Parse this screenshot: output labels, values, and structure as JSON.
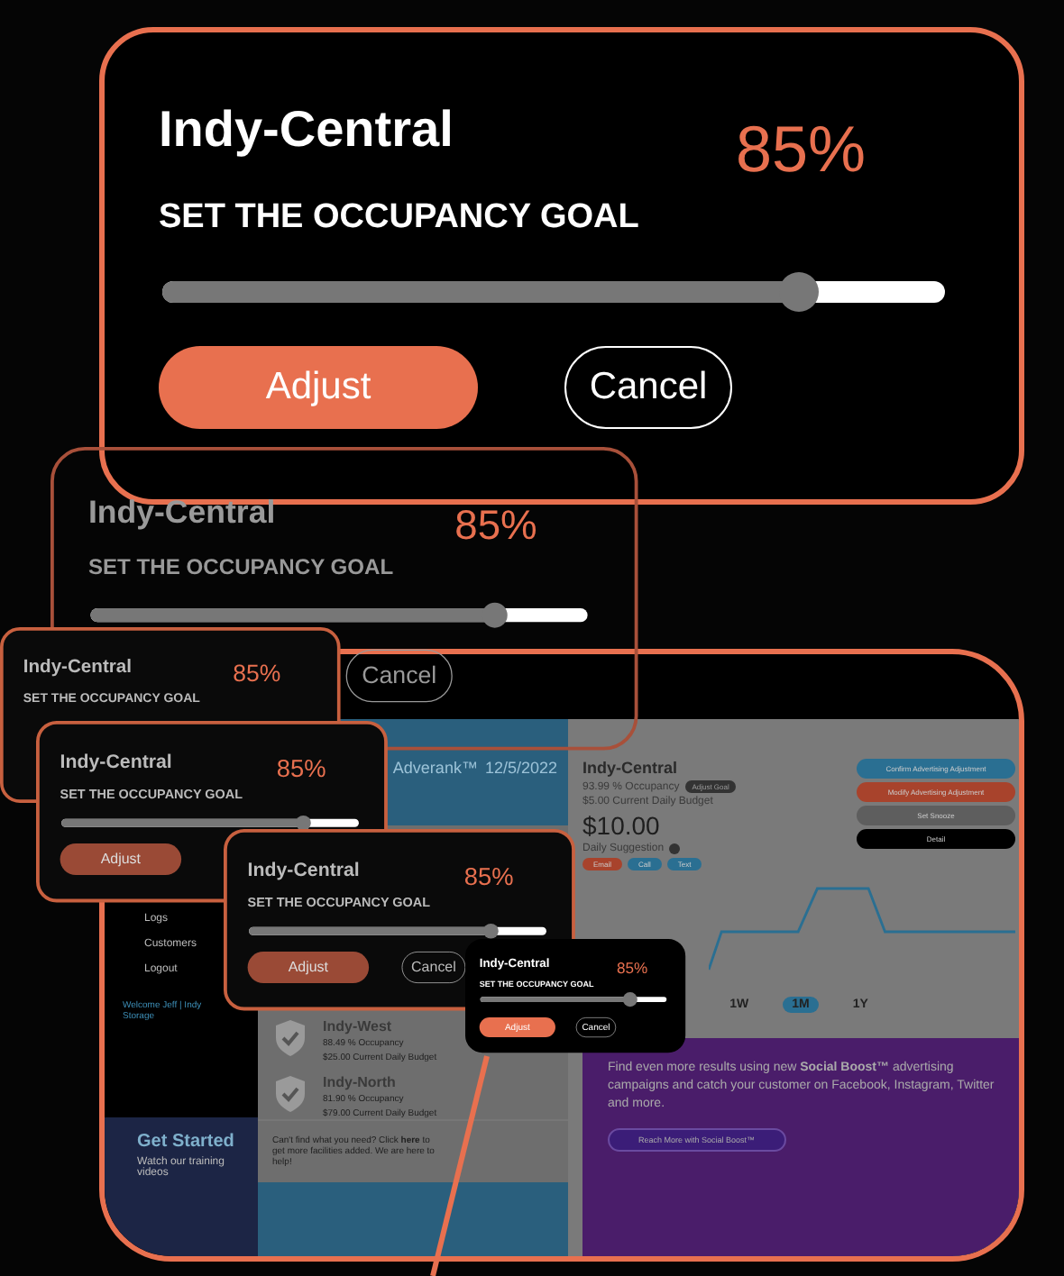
{
  "app": {
    "sidebar": {
      "items": [
        {
          "label": "Logs"
        },
        {
          "label": "Customers"
        },
        {
          "label": "Logout"
        }
      ],
      "welcome": "Welcome Jeff | Indy Storage",
      "get_started": {
        "title": "Get Started",
        "subtitle": "Watch our training videos"
      }
    },
    "header": {
      "brand": "Adverank™",
      "date": "12/5/2022"
    },
    "facilities": [
      {
        "name": "Indy-West",
        "occupancy": "88.49 % Occupancy",
        "budget": "$25.00 Current Daily Budget",
        "checked": true
      },
      {
        "name": "Indy-North",
        "occupancy": "81.90 % Occupancy",
        "budget": "$79.00 Current Daily Budget",
        "checked": true
      }
    ],
    "footer": "Can't find what you need? Click **here** to get more facilities added. We are here to help!",
    "detail": {
      "name": "Indy-Central",
      "occupancy": "93.99 % Occupancy",
      "adjust_goal": "Adjust Goal",
      "budget": "$5.00 Current Daily Budget",
      "amount": "$10.00",
      "suggestion": "Daily Suggestion",
      "contacts": [
        {
          "label": "Email",
          "color": "#a8432c"
        },
        {
          "label": "Call",
          "color": "#2a6f92"
        },
        {
          "label": "Text",
          "color": "#2a6f92"
        }
      ],
      "actions": [
        {
          "label": "Confirm Advertising Adjustment",
          "color": "#2a6f92"
        },
        {
          "label": "Modify Advertising Adjustment",
          "color": "#a8432c"
        },
        {
          "label": "Set Snooze",
          "color": "#5e5e5e"
        },
        {
          "label": "Detail",
          "color": "#000000"
        }
      ],
      "ranges": [
        {
          "label": "1W",
          "selected": false
        },
        {
          "label": "1M",
          "selected": true
        },
        {
          "label": "1Y",
          "selected": false
        }
      ],
      "promo": {
        "text": "Find even more results using new **Social Boost™** advertising campaigns and catch your customer on Facebook, Instagram, Twitter and more.",
        "button": "Reach More with Social Boost™"
      }
    }
  },
  "dialogs": [
    {
      "kind": "main",
      "title": "Indy-Central",
      "percent": "85%",
      "heading": "SET THE OCCUPANCY GOAL",
      "level": 0.83,
      "adjust": "Adjust",
      "cancel": "Cancel"
    },
    {
      "kind": "ghost",
      "title": "Indy-Central",
      "percent": "85%",
      "heading": "SET THE OCCUPANCY GOAL",
      "level": 0.83,
      "cancel": "Cancel"
    },
    {
      "kind": "echo",
      "title": "Indy-Central",
      "percent": "85%",
      "heading": "SET THE OCCUPANCY GOAL"
    },
    {
      "kind": "echo",
      "title": "Indy-Central",
      "percent": "85%",
      "heading": "SET THE OCCUPANCY GOAL",
      "level": 0.83,
      "adjust": "Adjust"
    },
    {
      "kind": "echo",
      "title": "Indy-Central",
      "percent": "85%",
      "heading": "SET THE OCCUPANCY GOAL",
      "level": 0.83,
      "adjust": "Adjust",
      "cancel": "Cancel"
    },
    {
      "kind": "mini",
      "title": "Indy-Central",
      "percent": "85%",
      "heading": "SET THE OCCUPANCY GOAL",
      "level": 0.83,
      "adjust": "Adjust",
      "cancel": "Cancel"
    }
  ]
}
